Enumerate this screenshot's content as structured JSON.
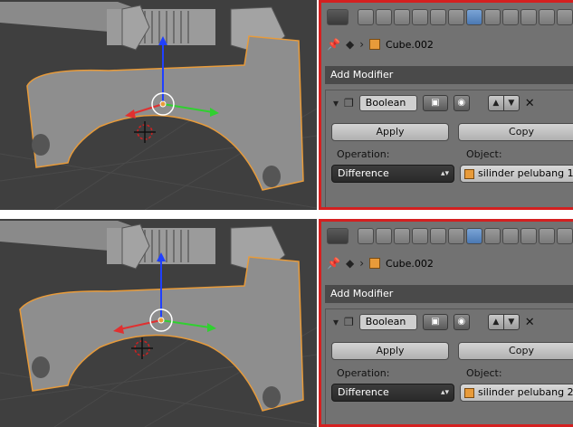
{
  "panels": [
    {
      "context": {
        "object_name": "Cube.002"
      },
      "add_modifier_label": "Add Modifier",
      "modifier": {
        "name": "Boolean",
        "apply_label": "Apply",
        "copy_label": "Copy",
        "operation_label": "Operation:",
        "operation_value": "Difference",
        "object_label": "Object:",
        "object_value": "silinder pelubang 1"
      }
    },
    {
      "context": {
        "object_name": "Cube.002"
      },
      "add_modifier_label": "Add Modifier",
      "modifier": {
        "name": "Boolean",
        "apply_label": "Apply",
        "copy_label": "Copy",
        "operation_label": "Operation:",
        "operation_value": "Difference",
        "object_label": "Object:",
        "object_value": "silinder pelubang 2"
      }
    }
  ],
  "icons": {
    "pin": "pin-icon",
    "object": "object-icon",
    "cube": "cube-icon",
    "wrench": "wrench-icon",
    "camera": "render-icon",
    "eye": "eye-icon"
  },
  "colors": {
    "highlight_border": "#d42020",
    "selection_outline": "#e89b3a",
    "axis_x": "#e03030",
    "axis_y": "#30d030",
    "axis_z": "#2040ff"
  }
}
